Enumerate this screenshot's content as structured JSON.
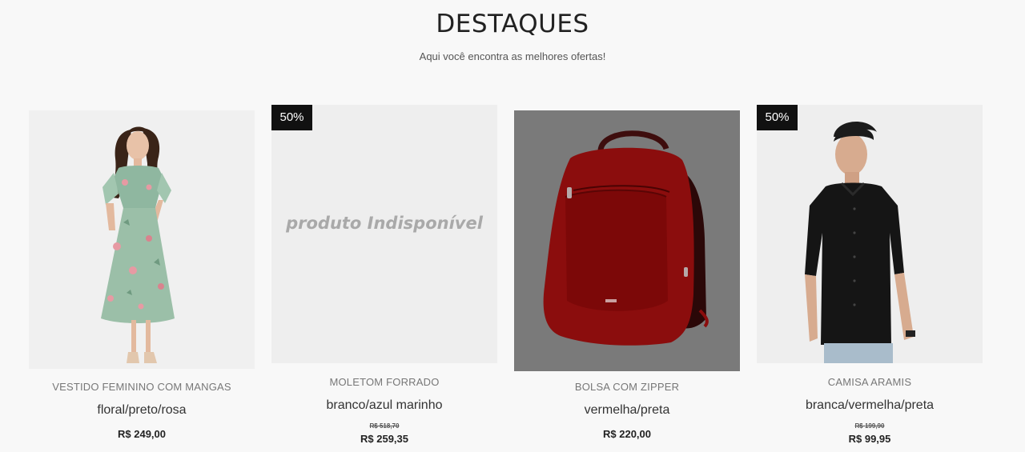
{
  "section": {
    "title": "DESTAQUES",
    "subtitle": "Aqui você encontra as melhores ofertas!"
  },
  "products": [
    {
      "name": "VESTIDO FEMININO COM MANGAS",
      "variant": "floral/preto/rosa",
      "price": "R$ 249,00",
      "image": "woman-floral-dress"
    },
    {
      "badge": "50%",
      "unavailable_text": "produto Indisponível",
      "name": "MOLETOM FORRADO",
      "variant": "branco/azul marinho",
      "old_price": "R$ 518,70",
      "price": "R$ 259,35"
    },
    {
      "name": "BOLSA COM ZIPPER",
      "variant": "vermelha/preta",
      "price": "R$ 220,00",
      "image": "red-backpack"
    },
    {
      "badge": "50%",
      "name": "CAMISA ARAMIS",
      "variant": "branca/vermelha/preta",
      "old_price": "R$ 199,90",
      "price": "R$ 99,95",
      "image": "man-black-shirt"
    }
  ]
}
